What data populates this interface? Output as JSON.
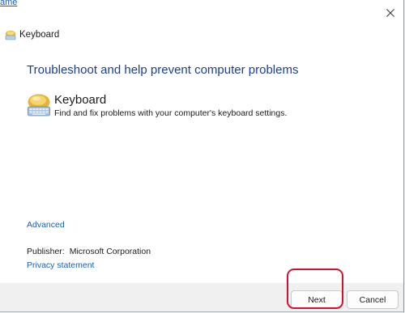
{
  "background": {
    "link_fragment": "ame"
  },
  "window": {
    "title": "Keyboard",
    "close_icon": "close-icon",
    "heading": "Troubleshoot and help prevent computer problems",
    "task": {
      "icon": "keyboard-icon",
      "title": "Keyboard",
      "description": "Find and fix problems with your computer's keyboard settings."
    },
    "advanced_label": "Advanced",
    "publisher_label": "Publisher:",
    "publisher_value": "Microsoft Corporation",
    "privacy_label": "Privacy statement"
  },
  "footer": {
    "next_label": "Next",
    "cancel_label": "Cancel"
  },
  "colors": {
    "heading": "#1d3f8c",
    "link": "#1a5fb4",
    "footer_bg": "#f0f0f0",
    "annotation": "#d2122e"
  }
}
